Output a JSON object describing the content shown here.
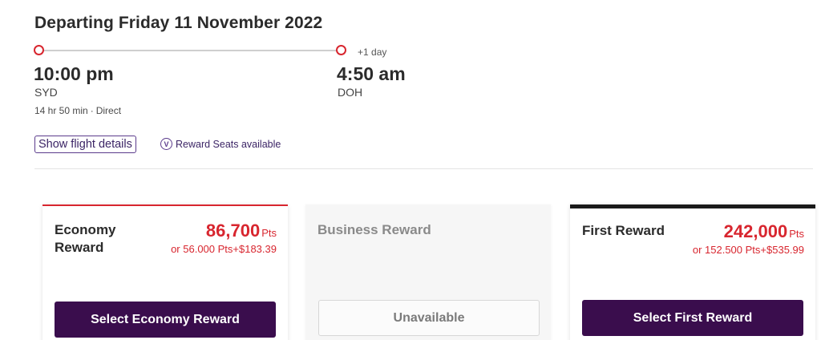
{
  "flight": {
    "heading": "Departing Friday 11 November 2022",
    "departure": {
      "time": "10:00 pm",
      "airport": "SYD"
    },
    "arrival": {
      "time": "4:50 am",
      "airport": "DOH",
      "day_offset": "+1 day"
    },
    "duration": "14 hr 50 min",
    "separator": "·",
    "stops": "Direct",
    "details_button": "Show flight details",
    "reward_seats": "Reward Seats available",
    "reward_icon_glyph": "V"
  },
  "fares": {
    "economy": {
      "title": "Economy Reward",
      "points": "86,700",
      "unit": "Pts",
      "alt": "or 56.000 Pts+$183.39",
      "button": "Select Economy Reward"
    },
    "business": {
      "title": "Business Reward",
      "button": "Unavailable"
    },
    "first": {
      "title": "First Reward",
      "points": "242,000",
      "unit": "Pts",
      "alt": "or 152.500 Pts+$535.99",
      "button": "Select First Reward"
    }
  },
  "colors": {
    "accent_red": "#d8262f",
    "brand_purple": "#3a0d4d",
    "link_purple": "#3c2566"
  }
}
